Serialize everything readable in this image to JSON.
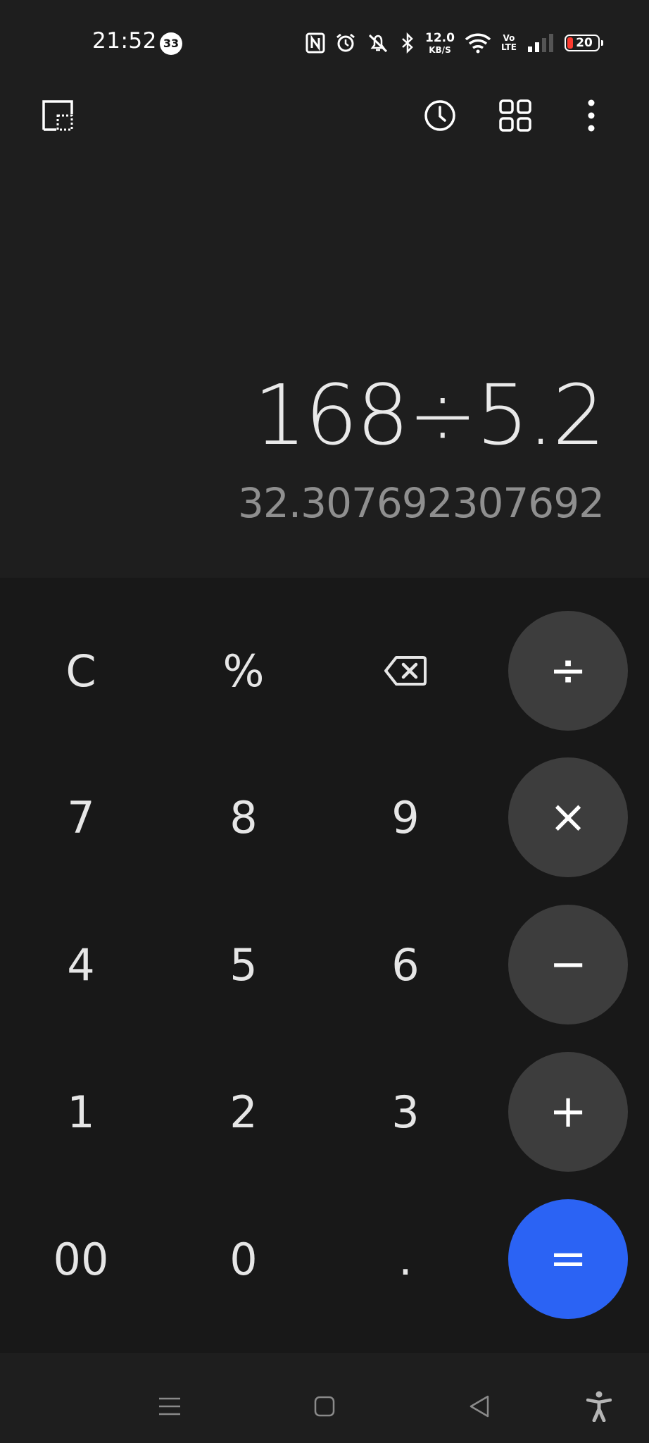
{
  "status_bar": {
    "time": "21:52",
    "notification_count": "33",
    "net_speed_value": "12.0",
    "net_speed_unit": "KB/S",
    "volte_top": "Vo",
    "volte_bottom": "LTE",
    "battery_level": "20",
    "battery_color": "#ff3b30"
  },
  "toolbar": {
    "icons": [
      "picture-in-picture-icon",
      "history-icon",
      "grid-icon",
      "more-vert-icon"
    ]
  },
  "display": {
    "expression": "168÷5.2",
    "result": "32.307692307692"
  },
  "keypad": {
    "row1": [
      "C",
      "%",
      "⌫",
      "÷"
    ],
    "row2": [
      "7",
      "8",
      "9",
      "×"
    ],
    "row3": [
      "4",
      "5",
      "6",
      "−"
    ],
    "row4": [
      "1",
      "2",
      "3",
      "+"
    ],
    "row5": [
      "00",
      "0",
      ".",
      "="
    ],
    "operator_color": "#3d3d3d",
    "equals_color": "#2b63f4"
  },
  "nav_bar": {
    "icons": [
      "menu-icon",
      "home-icon",
      "back-icon",
      "accessibility-icon"
    ]
  }
}
